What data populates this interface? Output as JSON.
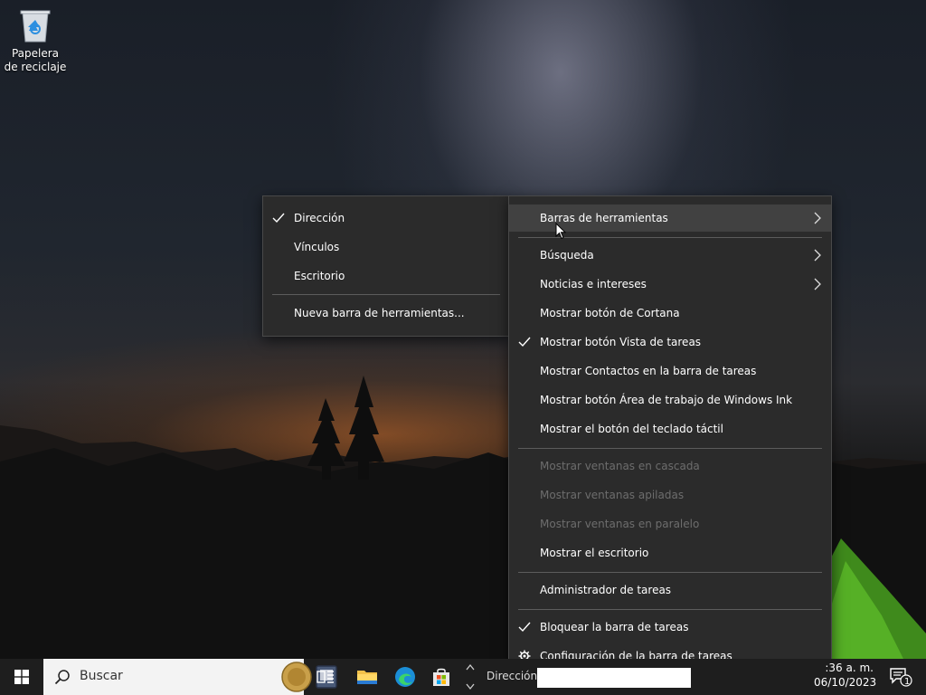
{
  "desktop": {
    "icons": [
      {
        "label": "Papelera de reciclaje",
        "icon": "recycle-bin-icon"
      }
    ]
  },
  "toolbars_submenu": {
    "items": [
      {
        "label": "Dirección",
        "checked": true
      },
      {
        "label": "Vínculos",
        "checked": false
      },
      {
        "label": "Escritorio",
        "checked": false
      },
      {
        "label": "Nueva barra de herramientas...",
        "checked": false
      }
    ]
  },
  "context_menu": {
    "items": [
      {
        "label": "Barras de herramientas",
        "submenu": true,
        "highlighted": true
      },
      {
        "label": "Búsqueda",
        "submenu": true
      },
      {
        "label": "Noticias e intereses",
        "submenu": true
      },
      {
        "label": "Mostrar botón de Cortana"
      },
      {
        "label": "Mostrar botón Vista de tareas",
        "checked": true
      },
      {
        "label": "Mostrar Contactos en la barra de tareas"
      },
      {
        "label": "Mostrar botón Área de trabajo de Windows Ink"
      },
      {
        "label": "Mostrar el botón del teclado táctil"
      },
      {
        "label": "Mostrar ventanas en cascada",
        "disabled": true
      },
      {
        "label": "Mostrar ventanas apiladas",
        "disabled": true
      },
      {
        "label": "Mostrar ventanas en paralelo",
        "disabled": true
      },
      {
        "label": "Mostrar el escritorio"
      },
      {
        "label": "Administrador de tareas"
      },
      {
        "label": "Bloquear la barra de tareas",
        "checked": true
      },
      {
        "label": "Configuración de la barra de tareas",
        "icon": "gear-icon"
      }
    ]
  },
  "taskbar": {
    "search_placeholder": "Buscar",
    "address_label": "Dirección",
    "clock_time": ":36 a. m.",
    "clock_date": "06/10/2023",
    "notification_count": "1",
    "colors": {
      "taskbar_bg": "#1e1e1e",
      "menu_bg": "#2b2b2b",
      "menu_hover": "#414141",
      "disabled_text": "#6d6d6d"
    }
  }
}
